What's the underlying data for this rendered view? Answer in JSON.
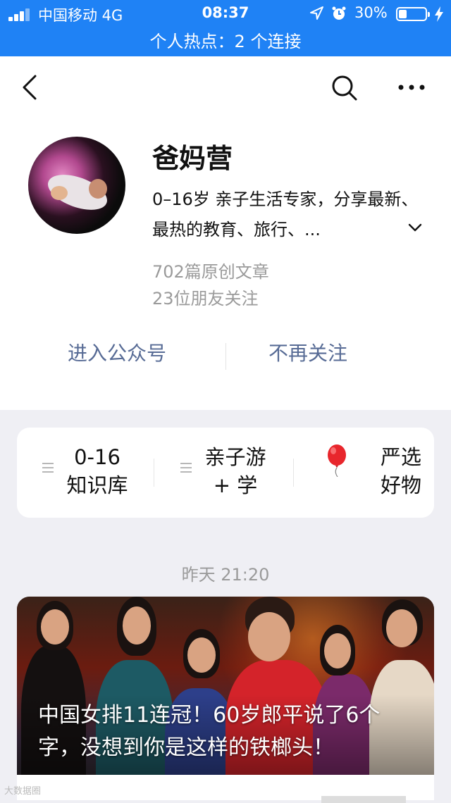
{
  "status_bar": {
    "carrier": "中国移动  4G",
    "time": "08:37",
    "battery": "30%",
    "battery_level": 0.3,
    "hotspot": "个人热点：2 个连接",
    "color": "#1f82f5"
  },
  "nav": {
    "back_icon": "chevron-left-icon",
    "search_icon": "search-icon",
    "more_icon": "more-dots-icon"
  },
  "account": {
    "name": "爸妈营",
    "description": "0–16岁 亲子生活专家，分享最新、最热的教育、旅行、...",
    "articles": "702篇原创文章",
    "followers": "23位朋友关注",
    "enter_label": "进入公众号",
    "unfollow_label": "不再关注",
    "link_color": "#576b95"
  },
  "menu": {
    "items": [
      {
        "label": "0-16\n知识库",
        "icon": "list-icon"
      },
      {
        "label": "亲子游\n+ 学",
        "icon": "list-icon"
      },
      {
        "label": "严选\n好物",
        "icon": "balloon-icon"
      }
    ]
  },
  "feed": {
    "date": "昨天 21:20",
    "article_title": "中国女排11连冠！60岁郎平说了6个字，没想到你是这样的铁榔头！",
    "watermark": "大数据圈"
  }
}
